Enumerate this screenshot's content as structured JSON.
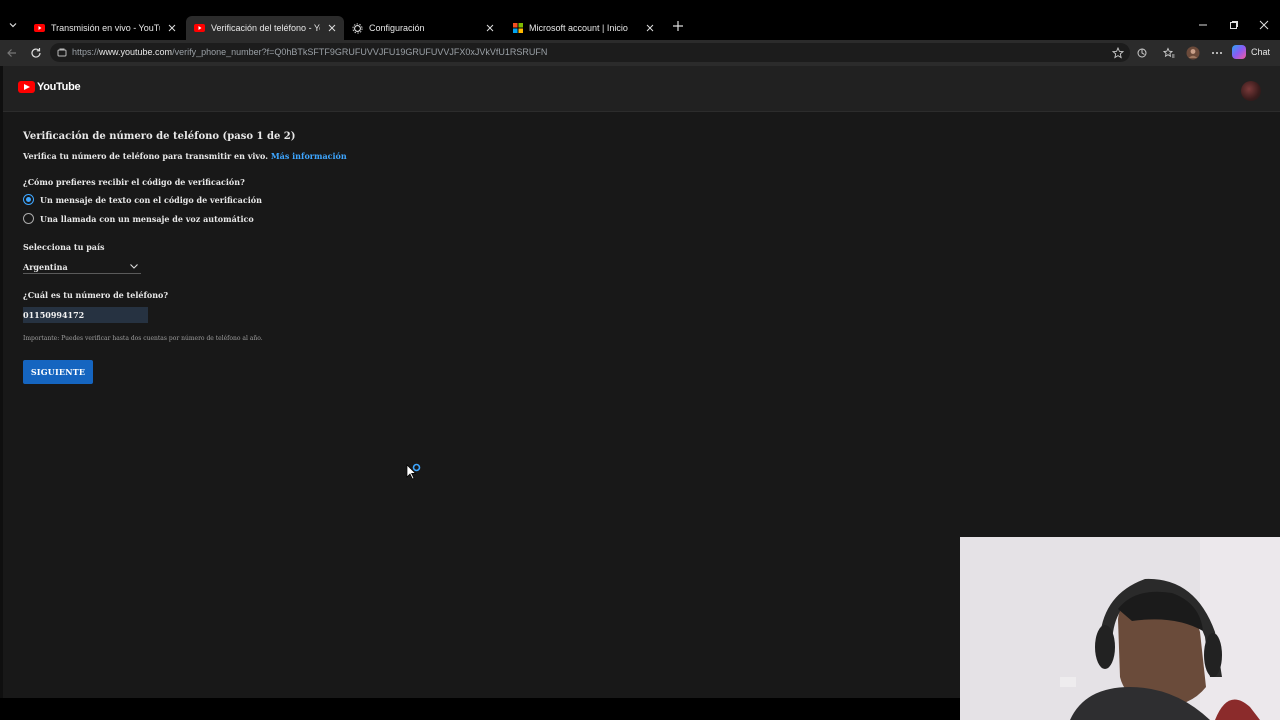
{
  "browser": {
    "tabs": [
      {
        "title": "Transmisión en vivo - YouTube Stu",
        "favicon": "youtube-icon",
        "active": false
      },
      {
        "title": "Verificación del teléfono - YouTub",
        "favicon": "youtube-icon",
        "active": true
      },
      {
        "title": "Configuración",
        "favicon": "gear-icon",
        "active": false
      },
      {
        "title": "Microsoft account | Inicio",
        "favicon": "microsoft-icon",
        "active": false
      }
    ],
    "url_scheme": "https://",
    "url_host": "www.youtube.com",
    "url_path": "/verify_phone_number?f=Q0hBTkSFTF9GRUFUVVJFU19GRUFUVVJFX0xJVkVfU1RSRUFN",
    "chat_label": "Chat"
  },
  "youtube": {
    "logo_text": "YouTube",
    "heading": "Verificación de número de teléfono (paso 1 de 2)",
    "subtitle": "Verifica tu número de teléfono para transmitir en vivo.",
    "more_info_link": "Más información",
    "method_question": "¿Cómo prefieres recibir el código de verificación?",
    "options": [
      {
        "label": "Un mensaje de texto con el código de verificación",
        "checked": true
      },
      {
        "label": "Una llamada con un mensaje de voz automático",
        "checked": false
      }
    ],
    "country_label": "Selecciona tu país",
    "country_value": "Argentina",
    "phone_label": "¿Cuál es tu número de teléfono?",
    "phone_value": "01150994172",
    "note": "Importante: Puedes verificar hasta dos cuentas por número de teléfono al año.",
    "next_button": "SIGUIENTE"
  },
  "colors": {
    "accent_blue": "#3ea6ff",
    "button_blue": "#1565c0",
    "youtube_red": "#ff0000"
  }
}
